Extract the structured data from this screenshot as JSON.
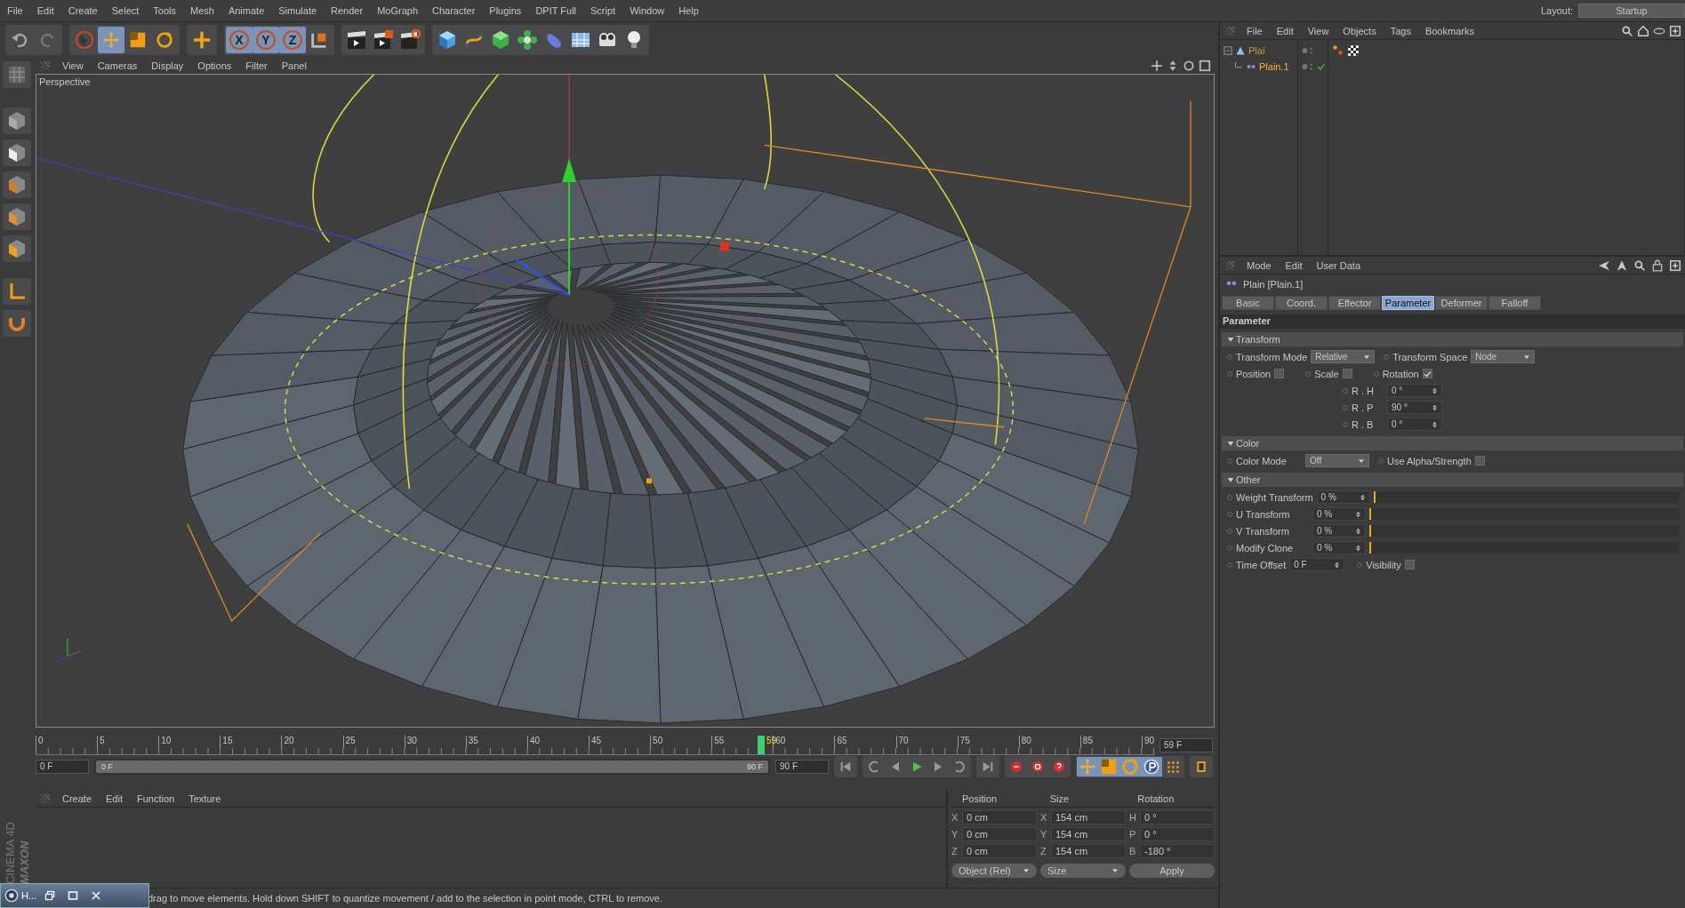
{
  "menu": [
    "File",
    "Edit",
    "Create",
    "Select",
    "Tools",
    "Mesh",
    "Animate",
    "Simulate",
    "Render",
    "MoGraph",
    "Character",
    "Plugins",
    "DPIT Full",
    "Script",
    "Window",
    "Help"
  ],
  "layout": {
    "label": "Layout:",
    "value": "Startup"
  },
  "toolbar": {
    "axis_lock": [
      {
        "label": "X",
        "on": true
      },
      {
        "label": "Y",
        "on": true
      },
      {
        "label": "Z",
        "on": true
      }
    ]
  },
  "viewport": {
    "menu": [
      "View",
      "Cameras",
      "Display",
      "Options",
      "Filter",
      "Panel"
    ],
    "camera": "Perspective"
  },
  "timeline": {
    "ticks": [
      "0",
      "5",
      "10",
      "15",
      "20",
      "25",
      "30",
      "35",
      "40",
      "45",
      "50",
      "55",
      "60",
      "65",
      "70",
      "75",
      "80",
      "85",
      "90"
    ],
    "current": "59",
    "level": 0.656,
    "frame": "59 F",
    "start": "0 F",
    "range": {
      "level": 1,
      "start": "0 F",
      "end": "90 F"
    },
    "end": "90 F"
  },
  "materials": {
    "menu": [
      "Create",
      "Edit",
      "Function",
      "Texture"
    ]
  },
  "brand": [
    "MAXON",
    "CINEMA 4D"
  ],
  "coordinates": {
    "headers": [
      "Position",
      "Size",
      "Rotation"
    ],
    "rows": [
      {
        "axes": [
          "X",
          "X",
          "H"
        ],
        "values": [
          "0 cm",
          "154 cm",
          "0 °"
        ]
      },
      {
        "axes": [
          "Y",
          "Y",
          "P"
        ],
        "values": [
          "0 cm",
          "154 cm",
          "0 °"
        ]
      },
      {
        "axes": [
          "Z",
          "Z",
          "B"
        ],
        "values": [
          "0 cm",
          "154 cm",
          "-180 °"
        ]
      }
    ],
    "mode": "Object (Rel)",
    "size_mode": "Size",
    "apply": "Apply"
  },
  "status": "drag to move elements. Hold down SHIFT to quantize movement / add to the selection in point mode, CTRL to remove.",
  "taskbar": {
    "label": "H..."
  },
  "object_manager": {
    "menu": [
      "File",
      "Edit",
      "View",
      "Objects",
      "Tags",
      "Bookmarks"
    ],
    "objects": [
      {
        "name": "Plai",
        "selected": false,
        "expanded": true,
        "children": [
          {
            "name": "Plain.1",
            "selected": true
          }
        ]
      }
    ]
  },
  "attributes": {
    "menu": [
      "Mode",
      "Edit",
      "User Data"
    ],
    "title": "Plain [Plain.1]",
    "tabs": [
      {
        "label": "Basic",
        "selected": false
      },
      {
        "label": "Coord.",
        "selected": false
      },
      {
        "label": "Effector",
        "selected": false
      },
      {
        "label": "Parameter",
        "selected": true
      },
      {
        "label": "Deformer",
        "selected": false
      },
      {
        "label": "Falloff",
        "selected": false
      }
    ],
    "section": "Parameter",
    "groups": [
      {
        "title": "Transform",
        "expanded": true,
        "rows": [
          {
            "items": [
              {
                "kind": "dropdown",
                "label": "Transform Mode",
                "value": "Relative"
              },
              {
                "kind": "dropdown",
                "label": "Transform Space",
                "value": "Node"
              }
            ]
          },
          {
            "items": [
              {
                "kind": "check",
                "label": "Position",
                "checked": false
              },
              {
                "kind": "check",
                "label": "Scale",
                "checked": false
              },
              {
                "kind": "check",
                "label": "Rotation",
                "checked": true
              }
            ]
          },
          {
            "items": [
              {
                "kind": "number",
                "label": "R . H",
                "value": "0 °"
              }
            ]
          },
          {
            "items": [
              {
                "kind": "number",
                "label": "R . P",
                "value": "90 °"
              }
            ]
          },
          {
            "items": [
              {
                "kind": "number",
                "label": "R . B",
                "value": "0 °"
              }
            ]
          }
        ]
      },
      {
        "title": "Color",
        "expanded": true,
        "rows": [
          {
            "items": [
              {
                "kind": "dropdown",
                "label": "Color Mode",
                "value": "Off"
              },
              {
                "kind": "check",
                "label": "Use Alpha/Strength",
                "checked": false
              }
            ]
          }
        ]
      },
      {
        "title": "Other",
        "expanded": true,
        "rows": [
          {
            "items": [
              {
                "kind": "slider",
                "label": "Weight Transform",
                "value": "0 %",
                "level": 0
              }
            ]
          },
          {
            "items": [
              {
                "kind": "slider",
                "label": "U Transform",
                "value": "0 %",
                "level": 0
              }
            ]
          },
          {
            "items": [
              {
                "kind": "slider",
                "label": "V Transform",
                "value": "0 %",
                "level": 0
              }
            ]
          },
          {
            "items": [
              {
                "kind": "slider",
                "label": "Modify Clone",
                "value": "0 %",
                "level": 0
              }
            ]
          },
          {
            "items": [
              {
                "kind": "time",
                "label": "Time Offset",
                "value": "0 F"
              },
              {
                "kind": "check",
                "label": "Visibility",
                "checked": false
              }
            ]
          }
        ]
      }
    ]
  }
}
